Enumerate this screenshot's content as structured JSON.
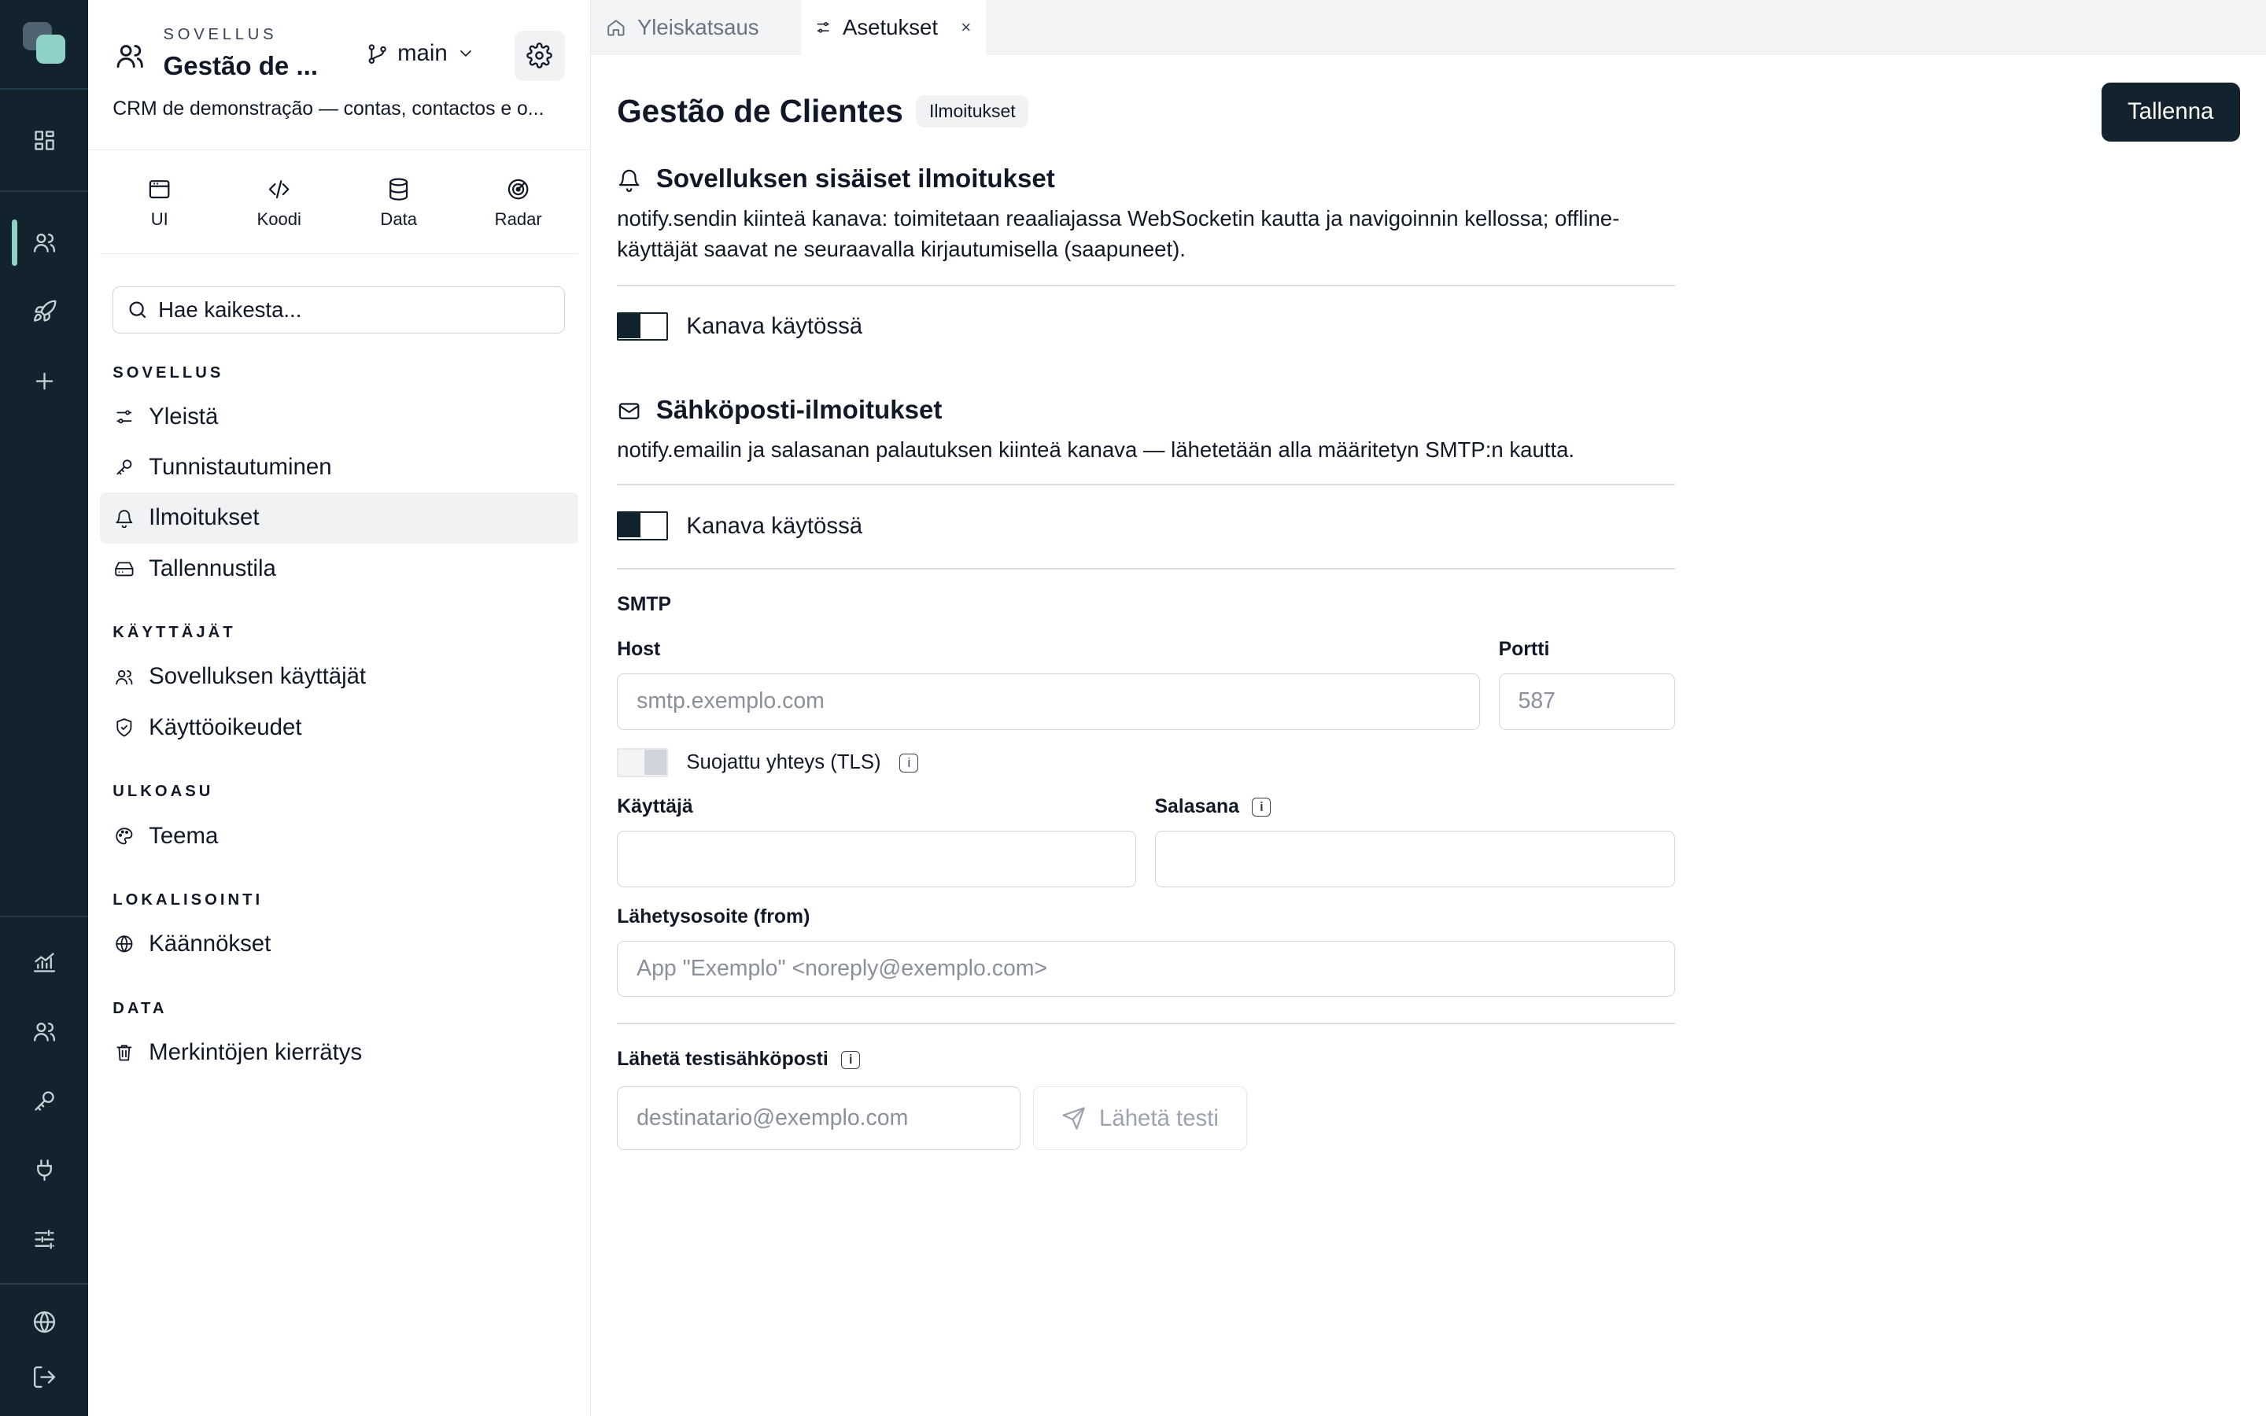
{
  "app": {
    "eyebrow": "SOVELLUS",
    "name": "Gestão de ...",
    "branch": "main",
    "description": "CRM de demonstração — contas, contactos e o..."
  },
  "modes": [
    {
      "label": "UI",
      "icon": "window-icon"
    },
    {
      "label": "Koodi",
      "icon": "code-icon"
    },
    {
      "label": "Data",
      "icon": "database-icon"
    },
    {
      "label": "Radar",
      "icon": "radar-icon"
    }
  ],
  "search": {
    "placeholder": "Hae kaikesta..."
  },
  "sidebar": {
    "sections": [
      {
        "title": "SOVELLUS",
        "items": [
          {
            "label": "Yleistä",
            "icon": "sliders-icon"
          },
          {
            "label": "Tunnistautuminen",
            "icon": "key-icon"
          },
          {
            "label": "Ilmoitukset",
            "icon": "bell-icon",
            "active": true
          },
          {
            "label": "Tallennustila",
            "icon": "drive-icon"
          }
        ]
      },
      {
        "title": "KÄYTTÄJÄT",
        "items": [
          {
            "label": "Sovelluksen käyttäjät",
            "icon": "users-icon"
          },
          {
            "label": "Käyttöoikeudet",
            "icon": "shield-check-icon"
          }
        ]
      },
      {
        "title": "ULKOASU",
        "items": [
          {
            "label": "Teema",
            "icon": "palette-icon"
          }
        ]
      },
      {
        "title": "LOKALISOINTI",
        "items": [
          {
            "label": "Käännökset",
            "icon": "globe-icon"
          }
        ]
      },
      {
        "title": "DATA",
        "items": [
          {
            "label": "Merkintöjen kierrätys",
            "icon": "trash-icon"
          }
        ]
      }
    ]
  },
  "tabs": [
    {
      "label": "Yleiskatsaus",
      "icon": "home-icon",
      "active": false
    },
    {
      "label": "Asetukset",
      "icon": "sliders-icon",
      "active": true,
      "close": "×"
    }
  ],
  "page": {
    "title": "Gestão de Clientes",
    "badge": "Ilmoitukset",
    "save_label": "Tallenna"
  },
  "in_app": {
    "title": "Sovelluksen sisäiset ilmoitukset",
    "description": "notify.sendin kiinteä kanava: toimitetaan reaaliajassa WebSocketin kautta ja navigoinnin kellossa; offline-käyttäjät saavat ne seuraavalla kirjautumisella (saapuneet).",
    "toggle_label": "Kanava käytössä",
    "enabled": true
  },
  "email": {
    "title": "Sähköposti-ilmoitukset",
    "description": "notify.emailin ja salasanan palautuksen kiinteä kanava — lähetetään alla määritetyn SMTP:n kautta.",
    "toggle_label": "Kanava käytössä",
    "enabled": true
  },
  "smtp": {
    "heading": "SMTP",
    "host_label": "Host",
    "host_placeholder": "smtp.exemplo.com",
    "port_label": "Portti",
    "port_placeholder": "587",
    "tls_label": "Suojattu yhteys (TLS)",
    "tls_enabled": false,
    "user_label": "Käyttäjä",
    "user_value": "",
    "password_label": "Salasana",
    "password_value": "",
    "from_label": "Lähetysosoite (from)",
    "from_placeholder": "App \"Exemplo\" <noreply@exemplo.com>"
  },
  "test": {
    "label": "Lähetä testisähköposti",
    "recipient_placeholder": "destinatario@exemplo.com",
    "button_label": "Lähetä testi"
  },
  "colors": {
    "rail_bg": "#12232e",
    "accent": "#8ed1c6",
    "primary_button": "#12232e"
  }
}
